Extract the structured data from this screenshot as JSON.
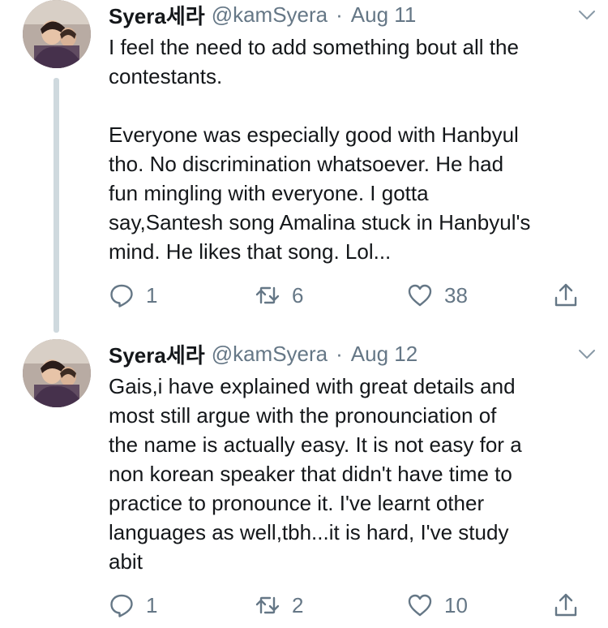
{
  "tweets": [
    {
      "display_name": "Syera세라",
      "handle": "@kamSyera",
      "separator": "·",
      "date": "Aug 11",
      "text": "I feel the need to add something bout all the\ncontestants.\n\nEveryone was especially good with Hanbyul\ntho. No discrimination whatsoever. He had\nfun mingling with everyone. I gotta\nsay,Santesh song Amalina stuck in Hanbyul's\nmind. He likes that song. Lol...",
      "replies": "1",
      "retweets": "6",
      "likes": "38"
    },
    {
      "display_name": "Syera세라",
      "handle": "@kamSyera",
      "separator": "·",
      "date": "Aug 12",
      "text": "Gais,i have explained with great details and\nmost still argue with the pronounciation of\nthe name is actually easy. It is not easy for a\nnon korean speaker that didn't have time to\npractice to pronounce it. I've learnt other\nlanguages as well,tbh...it is hard, I've study\nabit",
      "replies": "1",
      "retweets": "2",
      "likes": "10"
    }
  ],
  "icons": {
    "reply": "reply-icon",
    "retweet": "retweet-icon",
    "like": "heart-icon",
    "share": "share-icon",
    "caret": "chevron-down-icon",
    "avatar": "avatar-photo"
  },
  "colors": {
    "text": "#14171a",
    "secondary": "#657786",
    "thread_line": "#cfd9de",
    "background": "#ffffff"
  }
}
